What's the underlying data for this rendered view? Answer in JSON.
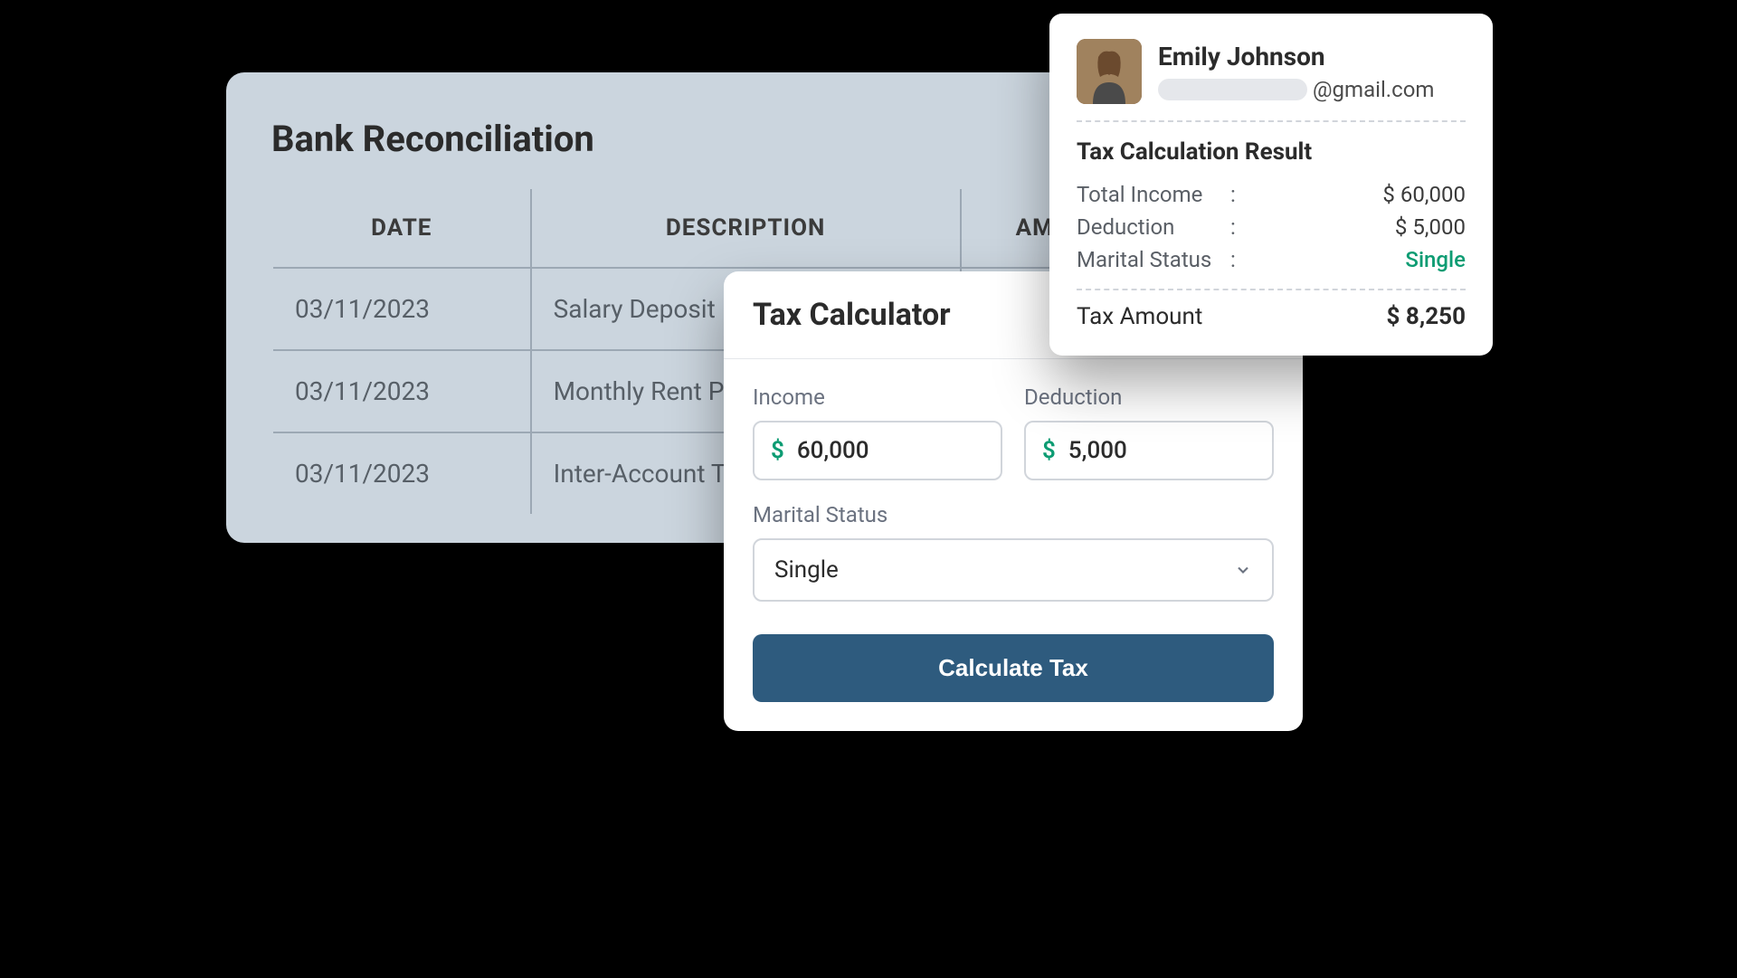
{
  "bank": {
    "title": "Bank Reconciliation",
    "columns": [
      "DATE",
      "DESCRIPTION",
      "AMOUNT"
    ],
    "rows": [
      {
        "date": "03/11/2023",
        "description": "Salary Deposit",
        "amount": ""
      },
      {
        "date": "03/11/2023",
        "description": "Monthly Rent Payment",
        "amount": ""
      },
      {
        "date": "03/11/2023",
        "description": "Inter-Account Transfer",
        "amount": ""
      }
    ]
  },
  "calculator": {
    "title": "Tax Calculator",
    "income_label": "Income",
    "income_value": "60,000",
    "deduction_label": "Deduction",
    "deduction_value": "5,000",
    "status_label": "Marital Status",
    "status_value": "Single",
    "button_label": "Calculate Tax",
    "currency_symbol": "$"
  },
  "profile": {
    "name": "Emily Johnson",
    "email_domain": "@gmail.com"
  },
  "result": {
    "title": "Tax Calculation Result",
    "lines": [
      {
        "label": "Total Income",
        "value": "$ 60,000"
      },
      {
        "label": "Deduction",
        "value": "$ 5,000"
      },
      {
        "label": "Marital Status",
        "value": "Single",
        "green": true
      }
    ],
    "tax_label": "Tax Amount",
    "tax_value": "$ 8,250"
  }
}
